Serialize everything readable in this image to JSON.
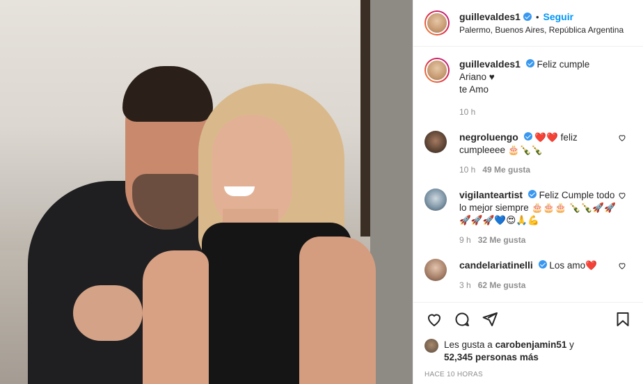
{
  "post": {
    "author": "guillevaldes1",
    "follow_label": "Seguir",
    "separator": "•",
    "location": "Palermo, Buenos Aires, República Argentina",
    "caption_line1": "Feliz cumple Ariano ♥",
    "caption_line2": "te Amo",
    "caption_time": "10 h",
    "time_ago": "HACE 10 HORAS"
  },
  "comments": [
    {
      "user": "negroluengo",
      "text": "❤️❤️ feliz cumpleeee 🎂🍾🍾",
      "time": "10 h",
      "likes": "49 Me gusta"
    },
    {
      "user": "vigilanteartist",
      "text": "Feliz Cumple todo lo mejor siempre 🎂🎂🎂 🍾🍾🚀🚀🚀🚀🚀💙😍🙏💪",
      "time": "9 h",
      "likes": "32 Me gusta"
    },
    {
      "user": "candelariatinelli",
      "text": "Los amo❤️",
      "time": "3 h",
      "likes": "62 Me gusta"
    }
  ],
  "likes_summary": {
    "prefix": "Les gusta a",
    "user": "carobenjamin51",
    "conj": "y",
    "count": "52,345 personas más"
  },
  "icons": {
    "like": "heart-icon",
    "comment": "comment-icon",
    "share": "share-icon",
    "save": "bookmark-icon",
    "verified": "verified-badge-icon"
  },
  "colors": {
    "accent": "#0095f6",
    "verified": "#3897f0",
    "muted": "#8e8e8e"
  }
}
